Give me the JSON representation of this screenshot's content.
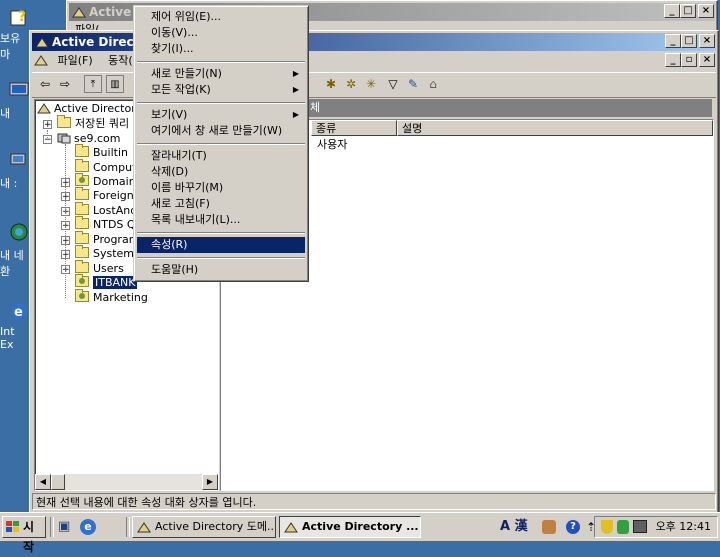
{
  "desktop": {
    "icons": [
      {
        "label": "보유",
        "label2": "마"
      },
      {
        "label": "내"
      },
      {
        "label": "내 :"
      },
      {
        "label": "내 네",
        "label2": "환"
      },
      {
        "label": "Int",
        "label2": "Ex"
      }
    ]
  },
  "back_window": {
    "title": "Active D",
    "menu_partial": "파일("
  },
  "main_window": {
    "title": "Active Directo",
    "menu": [
      "파일(F)",
      "동작("
    ],
    "tree": {
      "root": "Active Directory",
      "saved_queries": "저장된 쿼리",
      "domain": "se9.com",
      "children": [
        "Builtin",
        "Compute",
        "Domain",
        "ForeignS",
        "LostAnd",
        "NTDS Q",
        "Program",
        "System",
        "Users"
      ],
      "selected": "ITBANK",
      "after": "Marketing"
    },
    "right_header_partial": "체",
    "columns": [
      "종류",
      "설명"
    ],
    "row_value": "사용자",
    "status": "현재 선택 내용에 대한 속성 대화 상자를 엽니다."
  },
  "context_menu": {
    "groups": [
      [
        "제어 위임(E)...",
        "이동(V)...",
        "찾기(I)..."
      ],
      [
        "새로 만들기(N)",
        "모든 작업(K)"
      ],
      [
        "보기(V)",
        "여기에서 창 새로 만들기(W)"
      ],
      [
        "잘라내기(T)",
        "삭제(D)",
        "이름 바꾸기(M)",
        "새로 고침(F)",
        "목록 내보내기(L)..."
      ],
      [
        "속성(R)"
      ],
      [
        "도움말(H)"
      ]
    ],
    "submenu_items": [
      "새로 만들기(N)",
      "모든 작업(K)",
      "보기(V)"
    ],
    "selected": "속성(R)"
  },
  "taskbar": {
    "start": "시작",
    "tasks": [
      "Active Directory 도메...",
      "Active Directory ..."
    ],
    "tray_ime": "A 漢",
    "clock": "오후 12:41"
  },
  "colors": {
    "desktop": "#3a6ea5",
    "title_active": "#0a246a",
    "face": "#d4d0c8"
  }
}
